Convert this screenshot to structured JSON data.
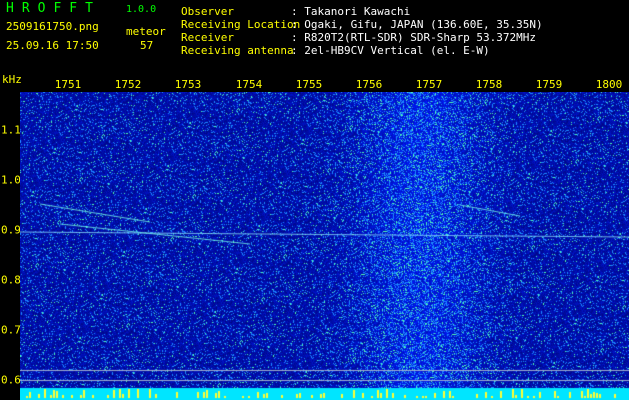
{
  "header": {
    "app_title": "HROFFT",
    "app_version": "1.0.0",
    "file_name": "2509161750.png",
    "datetime": "25.09.16 17:50",
    "meteor_label": "meteor",
    "meteor_count": "57"
  },
  "info": {
    "observer_label": "Observer",
    "observer_value": ": Takanori Kawachi",
    "location_label": "Receiving Location",
    "location_value": ": Ogaki, Gifu, JAPAN (136.60E, 35.35N)",
    "receiver_label": "Receiver",
    "receiver_value": ": R820T2(RTL-SDR) SDR-Sharp 53.372MHz",
    "antenna_label": "Receiving antenna",
    "antenna_value": ": 2el-HB9CV Vertical (el. E-W)"
  },
  "axis": {
    "freq_unit": "kHz",
    "time_ticks": [
      "1751",
      "1752",
      "1753",
      "1754",
      "1755",
      "1756",
      "1757",
      "1758",
      "1759",
      "1800"
    ],
    "freq_ticks": [
      "1.1",
      "1.0",
      "0.9",
      "0.8",
      "0.7",
      "0.6"
    ]
  },
  "colors": {
    "header_green": "#00ff00",
    "axis_yellow": "#ffff00",
    "spectrogram_base": "#001a6e",
    "baseline_cyan": "#00e5ff"
  }
}
